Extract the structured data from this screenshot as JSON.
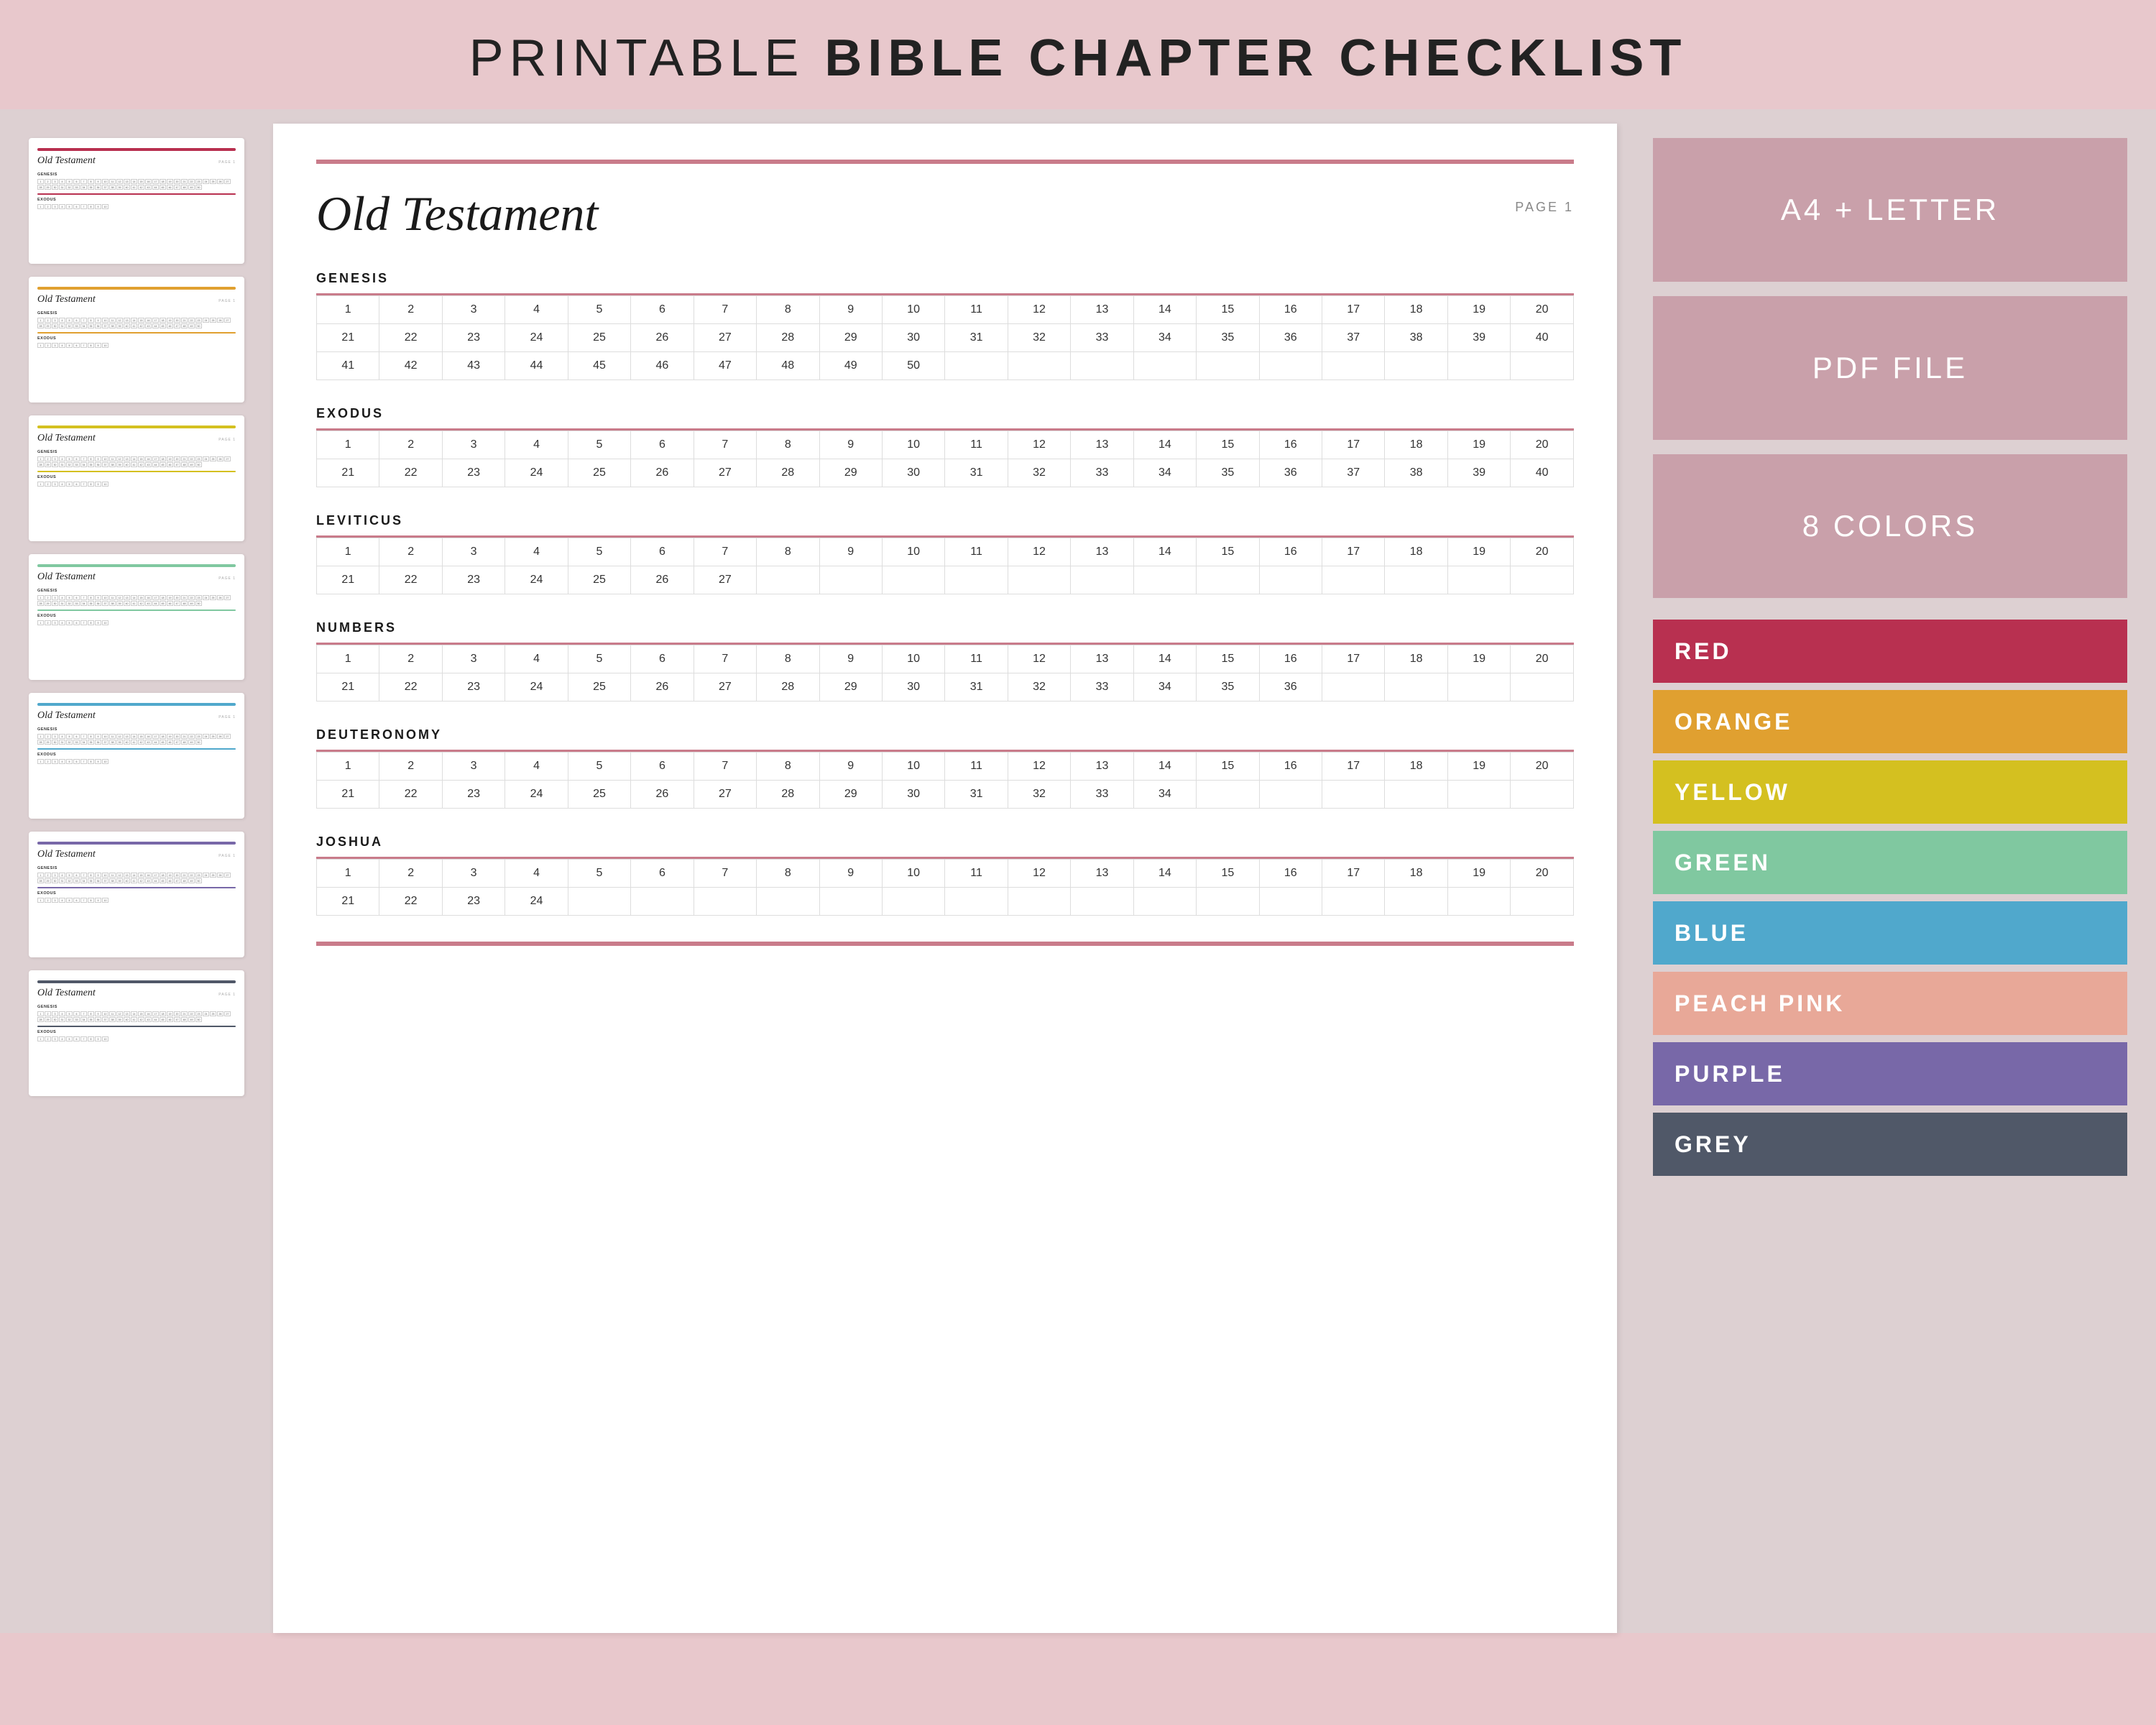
{
  "header": {
    "title_regular": "PRINTABLE ",
    "title_bold": "BIBLE CHAPTER CHECKLIST"
  },
  "thumbnails": [
    {
      "color": "#b83050",
      "divider": "#b83050",
      "label": "Red"
    },
    {
      "color": "#e0a030",
      "divider": "#e0a030",
      "label": "Orange"
    },
    {
      "color": "#d4c020",
      "divider": "#d4c020",
      "label": "Yellow"
    },
    {
      "color": "#80c8a0",
      "divider": "#80c8a0",
      "label": "Green"
    },
    {
      "color": "#50a8cc",
      "divider": "#50a8cc",
      "label": "Blue"
    },
    {
      "color": "#7868a8",
      "divider": "#7868a8",
      "label": "Purple"
    },
    {
      "color": "#505868",
      "divider": "#505868",
      "label": "Grey"
    }
  ],
  "preview": {
    "title": "Old Testament",
    "page_label": "PAGE 1",
    "top_bar_color": "#c97b8a",
    "books": [
      {
        "name": "GENESIS",
        "chapters": [
          [
            1,
            2,
            3,
            4,
            5,
            6,
            7,
            8,
            9,
            10,
            11,
            12,
            13,
            14,
            15,
            16,
            17,
            18,
            19,
            20
          ],
          [
            21,
            22,
            23,
            24,
            25,
            26,
            27,
            28,
            29,
            30,
            31,
            32,
            33,
            34,
            35,
            36,
            37,
            38,
            39,
            40
          ],
          [
            41,
            42,
            43,
            44,
            45,
            46,
            47,
            48,
            49,
            50,
            "",
            "",
            "",
            "",
            "",
            "",
            "",
            "",
            "",
            ""
          ]
        ]
      },
      {
        "name": "EXODUS",
        "chapters": [
          [
            1,
            2,
            3,
            4,
            5,
            6,
            7,
            8,
            9,
            10,
            11,
            12,
            13,
            14,
            15,
            16,
            17,
            18,
            19,
            20
          ],
          [
            21,
            22,
            23,
            24,
            25,
            26,
            27,
            28,
            29,
            30,
            31,
            32,
            33,
            34,
            35,
            36,
            37,
            38,
            39,
            40
          ]
        ]
      },
      {
        "name": "LEVITICUS",
        "chapters": [
          [
            1,
            2,
            3,
            4,
            5,
            6,
            7,
            8,
            9,
            10,
            11,
            12,
            13,
            14,
            15,
            16,
            17,
            18,
            19,
            20
          ],
          [
            21,
            22,
            23,
            24,
            25,
            26,
            27,
            "",
            "",
            "",
            "",
            "",
            "",
            "",
            "",
            "",
            "",
            "",
            "",
            ""
          ]
        ]
      },
      {
        "name": "NUMBERS",
        "chapters": [
          [
            1,
            2,
            3,
            4,
            5,
            6,
            7,
            8,
            9,
            10,
            11,
            12,
            13,
            14,
            15,
            16,
            17,
            18,
            19,
            20
          ],
          [
            21,
            22,
            23,
            24,
            25,
            26,
            27,
            28,
            29,
            30,
            31,
            32,
            33,
            34,
            35,
            36,
            "",
            "",
            "",
            ""
          ]
        ]
      },
      {
        "name": "DEUTERONOMY",
        "chapters": [
          [
            1,
            2,
            3,
            4,
            5,
            6,
            7,
            8,
            9,
            10,
            11,
            12,
            13,
            14,
            15,
            16,
            17,
            18,
            19,
            20
          ],
          [
            21,
            22,
            23,
            24,
            25,
            26,
            27,
            28,
            29,
            30,
            31,
            32,
            33,
            34,
            "",
            "",
            "",
            "",
            "",
            ""
          ]
        ]
      },
      {
        "name": "JOSHUA",
        "chapters": [
          [
            1,
            2,
            3,
            4,
            5,
            6,
            7,
            8,
            9,
            10,
            11,
            12,
            13,
            14,
            15,
            16,
            17,
            18,
            19,
            20
          ],
          [
            21,
            22,
            23,
            24,
            "",
            "",
            "",
            "",
            "",
            "",
            "",
            "",
            "",
            "",
            "",
            "",
            "",
            "",
            "",
            ""
          ]
        ]
      }
    ]
  },
  "info": {
    "size_label": "A4 + LETTER",
    "file_label": "PDF FILE",
    "colors_label": "8 COLORS",
    "badge_bg": "#c9a0aa"
  },
  "color_swatches": [
    {
      "name": "RED",
      "color": "#b83050"
    },
    {
      "name": "ORANGE",
      "color": "#e0a030"
    },
    {
      "name": "YELLOW",
      "color": "#d4c020"
    },
    {
      "name": "GREEN",
      "color": "#80c8a0"
    },
    {
      "name": "BLUE",
      "color": "#50a8cc"
    },
    {
      "name": "PEACH PINK",
      "color": "#e8a898"
    },
    {
      "name": "PURPLE",
      "color": "#7868a8"
    },
    {
      "name": "GREY",
      "color": "#505868"
    }
  ]
}
